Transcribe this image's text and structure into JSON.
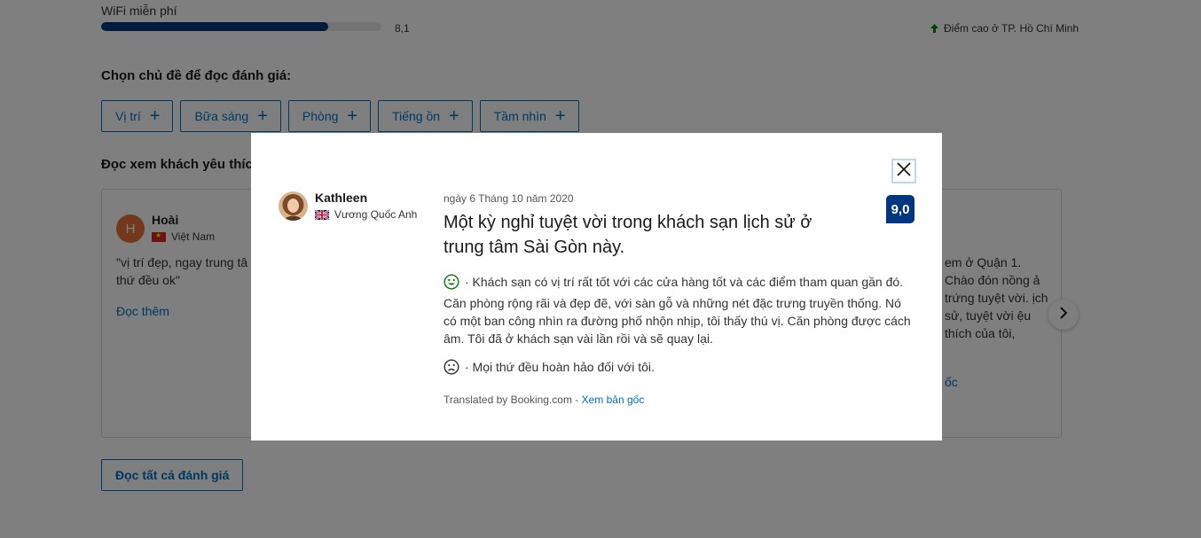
{
  "wifi": {
    "label": "WiFi miễn phí",
    "score": "8,1",
    "fill_fraction": 0.81,
    "city_high": "Điểm cao ở TP. Hồ Chí Minh"
  },
  "topics": {
    "title": "Chọn chủ đề để đọc đánh giá:",
    "items": [
      "Vị trí",
      "Bữa sáng",
      "Phòng",
      "Tiếng ồn",
      "Tầm nhìn"
    ]
  },
  "guests": {
    "title": "Đọc xem khách yêu thíc",
    "left_card": {
      "initial": "H",
      "name": "Hoài",
      "country": "Việt Nam",
      "quote": "\"vị trí đẹp, ngay trung tâ thứ đều ok\"",
      "read_more": "Đọc thêm"
    },
    "right_card": {
      "quote": "em ở Quận 1. Chào đón nồng ả trứng tuyệt vời. ịch sử, tuyệt vời ệu thích của tôi,",
      "read_more": "ốc"
    }
  },
  "read_all": "Đọc tất cả đánh giá",
  "modal": {
    "reviewer_name": "Kathleen",
    "reviewer_country": "Vương Quốc Anh",
    "date": "ngày 6 Tháng 10 năm 2020",
    "title": "Một kỳ nghỉ tuyệt vời trong khách sạn lịch sử ở trung tâm Sài Gòn này.",
    "score": "9,0",
    "positive": "· Khách sạn có vị trí rất tốt với các cửa hàng tốt và các điểm tham quan gần đó. Căn phòng rộng rãi và đẹp đẽ, với sàn gỗ và những nét đặc trưng truyền thống. Nó có một ban công nhìn ra đường phố nhộn nhịp, tôi thấy thú vị. Căn phòng được cách âm. Tôi đã ở khách sạn vài lần rồi và sẽ quay lại.",
    "negative": "· Mọi thứ đều hoàn hảo đối với tôi.",
    "translated_by": "Translated by Booking.com - ",
    "view_original": "Xem bản gốc"
  },
  "colors": {
    "brand_blue": "#003580",
    "link_blue": "#0071c2",
    "positive_green": "#008009",
    "city_high_green": "#008009"
  }
}
